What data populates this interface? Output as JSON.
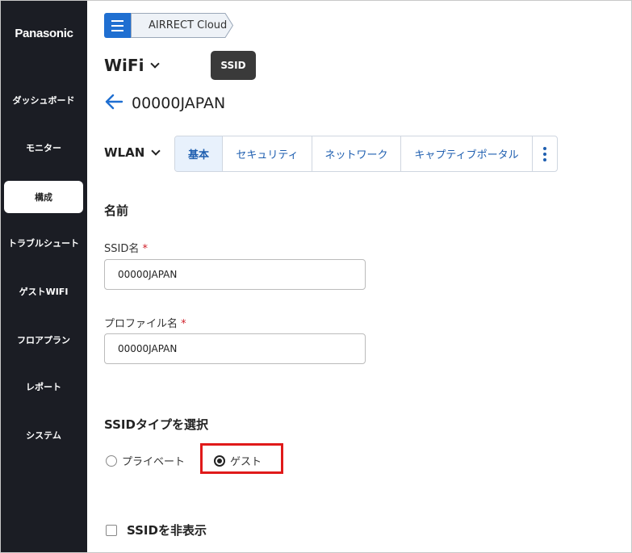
{
  "sidebar": {
    "brand": "Panasonic",
    "items": [
      {
        "label": "ダッシュボード",
        "active": false
      },
      {
        "label": "モニター",
        "active": false
      },
      {
        "label": "構成",
        "active": true
      },
      {
        "label": "トラブルシュート",
        "active": false
      },
      {
        "label": "ゲストWIFI",
        "active": false
      },
      {
        "label": "フロアプラン",
        "active": false
      },
      {
        "label": "レポート",
        "active": false
      },
      {
        "label": "システム",
        "active": false
      }
    ]
  },
  "breadcrumb": {
    "menu_icon": "hamburger-icon",
    "crumb": "AIRRECT Cloud"
  },
  "header": {
    "title": "WiFi",
    "tooltip": "SSID",
    "ssid_name": "00000JAPAN",
    "back_icon": "arrow-left-icon"
  },
  "wlan_selector": "WLAN",
  "tabs": [
    {
      "label": "基本",
      "active": true
    },
    {
      "label": "セキュリティ",
      "active": false
    },
    {
      "label": "ネットワーク",
      "active": false
    },
    {
      "label": "キャプティブポータル",
      "active": false
    }
  ],
  "form": {
    "name_section": "名前",
    "ssid_label": "SSID名",
    "ssid_value": "00000JAPAN",
    "profile_label": "プロファイル名",
    "profile_value": "00000JAPAN",
    "required_mark": "*",
    "type_section": "SSIDタイプを選択",
    "type_options": [
      {
        "label": "プライベート",
        "checked": false
      },
      {
        "label": "ゲスト",
        "checked": true
      }
    ],
    "hide_ssid_label": "SSIDを非表示"
  },
  "colors": {
    "sidebar_bg": "#1b1d24",
    "accent": "#1f6fd1",
    "highlight": "#e01a1a",
    "required": "#d0202a"
  }
}
